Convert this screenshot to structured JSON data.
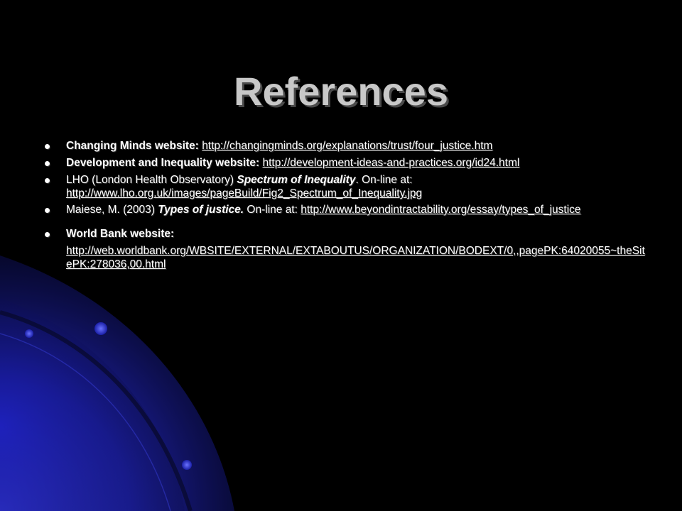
{
  "slide": {
    "title": "References",
    "references": [
      {
        "lead": "Changing Minds website:",
        "url": "http://changingminds.org/explanations/trust/four_justice.htm"
      },
      {
        "lead": "Development and Inequality website:",
        "url": "http://development-ideas-and-practices.org/id24.html"
      },
      {
        "author": "LHO (London Health Observatory)",
        "work": "Spectrum of Inequality",
        "suffix": ". On-line at:",
        "url": "http://www.lho.org.uk/images/pageBuild/Fig2_Spectrum_of_Inequality.jpg"
      },
      {
        "author": "Maiese, M. (2003)",
        "work": "Types of justice.",
        "suffix": " On-line at:",
        "url": "http://www.beyondintractability.org/essay/types_of_justice"
      },
      {
        "lead": "World Bank website:",
        "url": "http://web.worldbank.org/WBSITE/EXTERNAL/EXTABOUTUS/ORGANIZATION/BODEXT/0,,pagePK:64020055~theSitePK:278036,00.html"
      }
    ]
  },
  "colors": {
    "background": "#000000",
    "title": "#c8c8c8",
    "text": "#ffffff",
    "accent_glow": "#1e22c8"
  }
}
